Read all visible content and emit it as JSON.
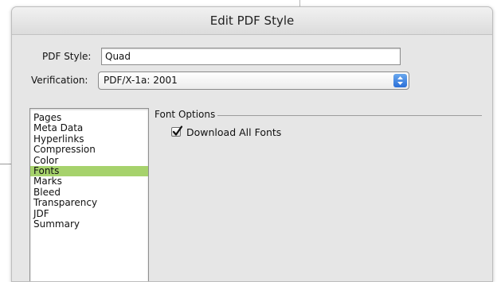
{
  "window": {
    "title": "Edit PDF Style"
  },
  "pdf_style": {
    "label": "PDF Style:",
    "value": "Quad"
  },
  "verification": {
    "label": "Verification:",
    "value": "PDF/X-1a: 2001"
  },
  "categories": {
    "items": [
      "Pages",
      "Meta Data",
      "Hyperlinks",
      "Compression",
      "Color",
      "Fonts",
      "Marks",
      "Bleed",
      "Transparency",
      "JDF",
      "Summary"
    ],
    "selected": "Fonts"
  },
  "font_options": {
    "group_title": "Font Options",
    "download_all_fonts": {
      "label": "Download All Fonts",
      "checked": true
    }
  },
  "colors": {
    "selection": "#a6d26c"
  }
}
